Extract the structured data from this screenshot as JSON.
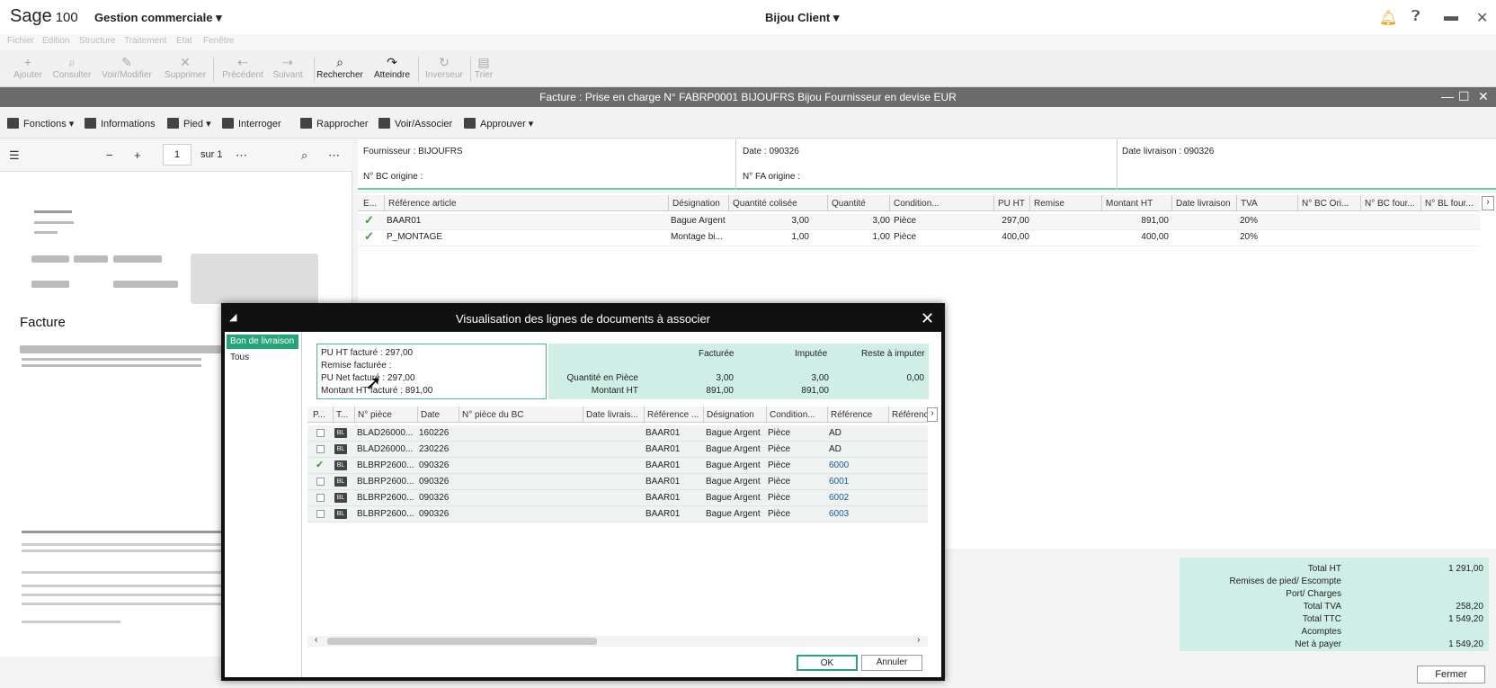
{
  "appbar": {
    "logo": "Sage",
    "version": "100",
    "module": "Gestion commerciale ▾",
    "company": "Bijou Client ▾"
  },
  "menu": [
    "Fichier",
    "Edition",
    "Structure",
    "Traitement",
    "Etat",
    "Fenêtre"
  ],
  "toolbar": [
    {
      "label": "Ajouter",
      "icon": "+",
      "on": false
    },
    {
      "label": "Consulter",
      "icon": "⌕",
      "on": false
    },
    {
      "label": "Voir/Modifier",
      "icon": "✎",
      "on": false
    },
    {
      "label": "Supprimer",
      "icon": "✕",
      "on": false
    },
    {
      "label": "Précédent",
      "icon": "⇠",
      "on": false
    },
    {
      "label": "Suivant",
      "icon": "⇢",
      "on": false
    },
    {
      "label": "Rechercher",
      "icon": "⌕",
      "on": true
    },
    {
      "label": "Atteindre",
      "icon": "↷",
      "on": true
    },
    {
      "label": "Inverseur",
      "icon": "↻",
      "on": false
    },
    {
      "label": "Trier",
      "icon": "▤",
      "on": false
    }
  ],
  "window": {
    "title": "Facture : Prise en charge N° FABRP0001 BIJOUFRS Bijou Fournisseur en devise EUR"
  },
  "actions": [
    "Fonctions ▾",
    "Informations",
    "Pied ▾",
    "Interroger",
    "Rapprocher",
    "Voir/Associer",
    "Approuver ▾"
  ],
  "preview": {
    "page": "1",
    "of": "sur 1",
    "doc_title": "Facture"
  },
  "header": {
    "fournisseur": "Fournisseur : BIJOUFRS",
    "bc_origine": "N° BC origine :",
    "date": "Date : 090326",
    "fa_origine": "N° FA origine :",
    "date_livraison": "Date livraison : 090326"
  },
  "grid": {
    "columns": [
      "E...",
      "Référence article",
      "Désignation",
      "Quantité colisée",
      "Quantité",
      "Condition...",
      "PU HT",
      "Remise",
      "Montant HT",
      "Date livraison",
      "TVA",
      "N° BC Ori...",
      "N° BC four...",
      "N° BL four..."
    ],
    "rows": [
      {
        "ref": "BAAR01",
        "designation": "Bague Argent",
        "qte_col": "3,00",
        "qte": "3,00",
        "cond": "Pièce",
        "pu": "297,00",
        "montant": "891,00",
        "tva": "20%"
      },
      {
        "ref": "P_MONTAGE",
        "designation": "Montage bi...",
        "qte_col": "1,00",
        "qte": "1,00",
        "cond": "Pièce",
        "pu": "400,00",
        "montant": "400,00",
        "tva": "20%"
      }
    ]
  },
  "totals": [
    {
      "label": "Total HT",
      "value": "1 291,00"
    },
    {
      "label": "Remises de pied/ Escompte",
      "value": ""
    },
    {
      "label": "Port/ Charges",
      "value": ""
    },
    {
      "label": "Total TVA",
      "value": "258,20"
    },
    {
      "label": "Total TTC",
      "value": "1 549,20"
    },
    {
      "label": "Acomptes",
      "value": ""
    },
    {
      "label": "Net à payer",
      "value": "1 549,20"
    }
  ],
  "fermer": "Fermer",
  "modal": {
    "title": "Visualisation des lignes de documents à associer",
    "left": [
      "Bon de livraison",
      "Tous"
    ],
    "pu": [
      "PU HT facturé : 297,00",
      "Remise facturée :",
      "PU Net facturé : 297,00",
      "Montant HT facturé : 891,00"
    ],
    "q_headers": [
      "Facturée",
      "Imputée",
      "Reste à imputer"
    ],
    "q_rows": [
      {
        "label": "Quantité en Pièce",
        "f": "3,00",
        "i": "3,00",
        "r": "0,00"
      },
      {
        "label": "Montant HT",
        "f": "891,00",
        "i": "891,00",
        "r": ""
      }
    ],
    "columns": [
      "P...",
      "T...",
      "N° pièce",
      "Date",
      "N° pièce du BC",
      "Date livrais...",
      "Référence ...",
      "Désignation",
      "Condition...",
      "Référence",
      "Référenc"
    ],
    "rows": [
      {
        "checked": false,
        "piece": "BLAD26000...",
        "date": "160226",
        "ref": "BAAR01",
        "des": "Bague Argent",
        "cond": "Pièce",
        "reference": "AD",
        "link": false
      },
      {
        "checked": false,
        "piece": "BLAD26000...",
        "date": "230226",
        "ref": "BAAR01",
        "des": "Bague Argent",
        "cond": "Pièce",
        "reference": "AD",
        "link": false
      },
      {
        "checked": true,
        "piece": "BLBRP2600...",
        "date": "090326",
        "ref": "BAAR01",
        "des": "Bague Argent",
        "cond": "Pièce",
        "reference": "6000",
        "link": true
      },
      {
        "checked": false,
        "piece": "BLBRP2600...",
        "date": "090326",
        "ref": "BAAR01",
        "des": "Bague Argent",
        "cond": "Pièce",
        "reference": "6001",
        "link": true
      },
      {
        "checked": false,
        "piece": "BLBRP2600...",
        "date": "090326",
        "ref": "BAAR01",
        "des": "Bague Argent",
        "cond": "Pièce",
        "reference": "6002",
        "link": true
      },
      {
        "checked": false,
        "piece": "BLBRP2600...",
        "date": "090326",
        "ref": "BAAR01",
        "des": "Bague Argent",
        "cond": "Pièce",
        "reference": "6003",
        "link": true
      }
    ],
    "type_badge": "BL",
    "ok": "OK",
    "annuler": "Annuler"
  },
  "colors": {
    "accent": "#25a47c",
    "teal_light": "#cfeee6",
    "title_bar": "#6b6b6b"
  }
}
